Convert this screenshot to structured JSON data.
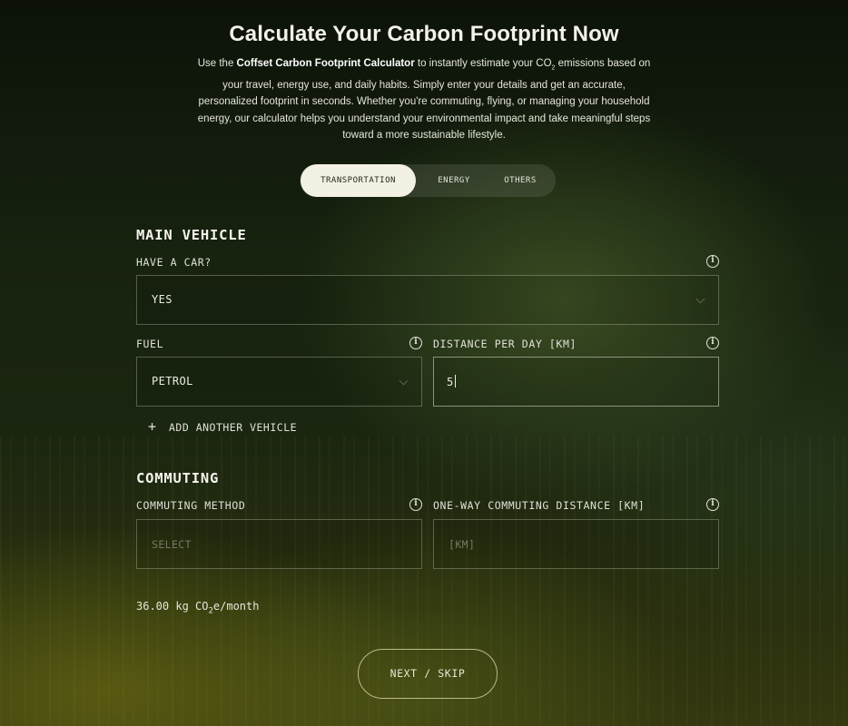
{
  "page": {
    "title": "Calculate Your Carbon Footprint Now",
    "intro": {
      "pre": "Use the ",
      "brand": "Coffset Carbon Footprint Calculator",
      "mid": " to instantly estimate your CO",
      "sub": "2",
      "post": " emissions based on your travel, energy use, and daily habits. Simply enter your details and get an accurate, personalized footprint in seconds. Whether you're commuting, flying, or managing your household energy, our calculator helps you understand your environmental impact and take meaningful steps toward a more sustainable lifestyle."
    }
  },
  "tabs": [
    {
      "label": "TRANSPORTATION",
      "active": true
    },
    {
      "label": "ENERGY",
      "active": false
    },
    {
      "label": "OTHERS",
      "active": false
    }
  ],
  "main_vehicle": {
    "title": "MAIN VEHICLE",
    "have_car": {
      "label": "HAVE A CAR?",
      "value": "YES"
    },
    "fuel": {
      "label": "FUEL",
      "value": "PETROL"
    },
    "distance": {
      "label": "DISTANCE PER DAY [KM]",
      "value": "5"
    },
    "add_vehicle_label": "ADD ANOTHER VEHICLE"
  },
  "commuting": {
    "title": "COMMUTING",
    "method": {
      "label": "COMMUTING METHOD",
      "placeholder": "SELECT"
    },
    "distance": {
      "label": "ONE-WAY COMMUTING DISTANCE [KM]",
      "placeholder": "[KM]"
    }
  },
  "result": {
    "amount": "36.00 kg CO",
    "sub": "2",
    "unit": "e/month"
  },
  "actions": {
    "next_label": "NEXT / SKIP"
  },
  "icons": {
    "info": "info-icon",
    "chevron": "chevron-down-icon",
    "plus": "plus-icon"
  },
  "colors": {
    "background": "#17220f",
    "active_tab": "#f3f1e4",
    "text": "#e8e8e0"
  }
}
